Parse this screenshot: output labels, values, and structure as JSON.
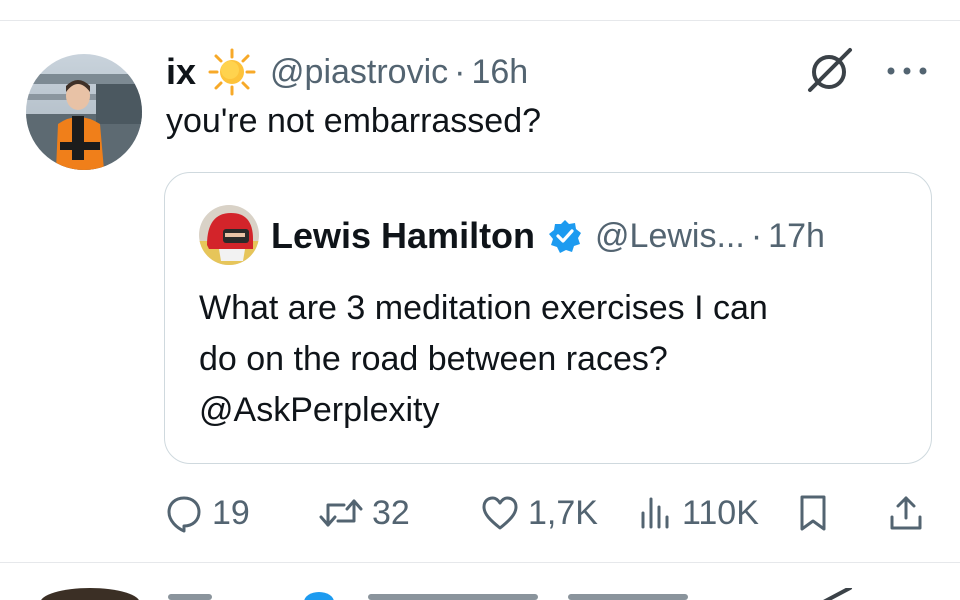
{
  "tweet": {
    "display_name": "ix",
    "name_emoji": "sun-icon",
    "handle": "@piastrovic",
    "separator": "·",
    "time": "16h",
    "text": "you're not embarrassed?",
    "avatar": "avatar-photo"
  },
  "quoted_tweet": {
    "display_name": "Lewis Hamilton",
    "verified": true,
    "handle": "@Lewis...",
    "separator": "·",
    "time": "17h",
    "text_lines": [
      "What are 3 meditation exercises I can",
      "do on the road between races?",
      "@AskPerplexity"
    ],
    "avatar": "helmet-avatar"
  },
  "actions": {
    "replies": "19",
    "retweets": "32",
    "likes": "1,7K",
    "views": "110K"
  },
  "icons": [
    "grok-icon",
    "more-icon",
    "reply-icon",
    "retweet-icon",
    "like-icon",
    "views-icon",
    "bookmark-icon",
    "share-icon",
    "verified-icon"
  ],
  "colors": {
    "text": "#0f1419",
    "secondary": "#536471",
    "border": "#cfd9de",
    "divider": "#e6e8eb",
    "verified": "#1d9bf0"
  }
}
